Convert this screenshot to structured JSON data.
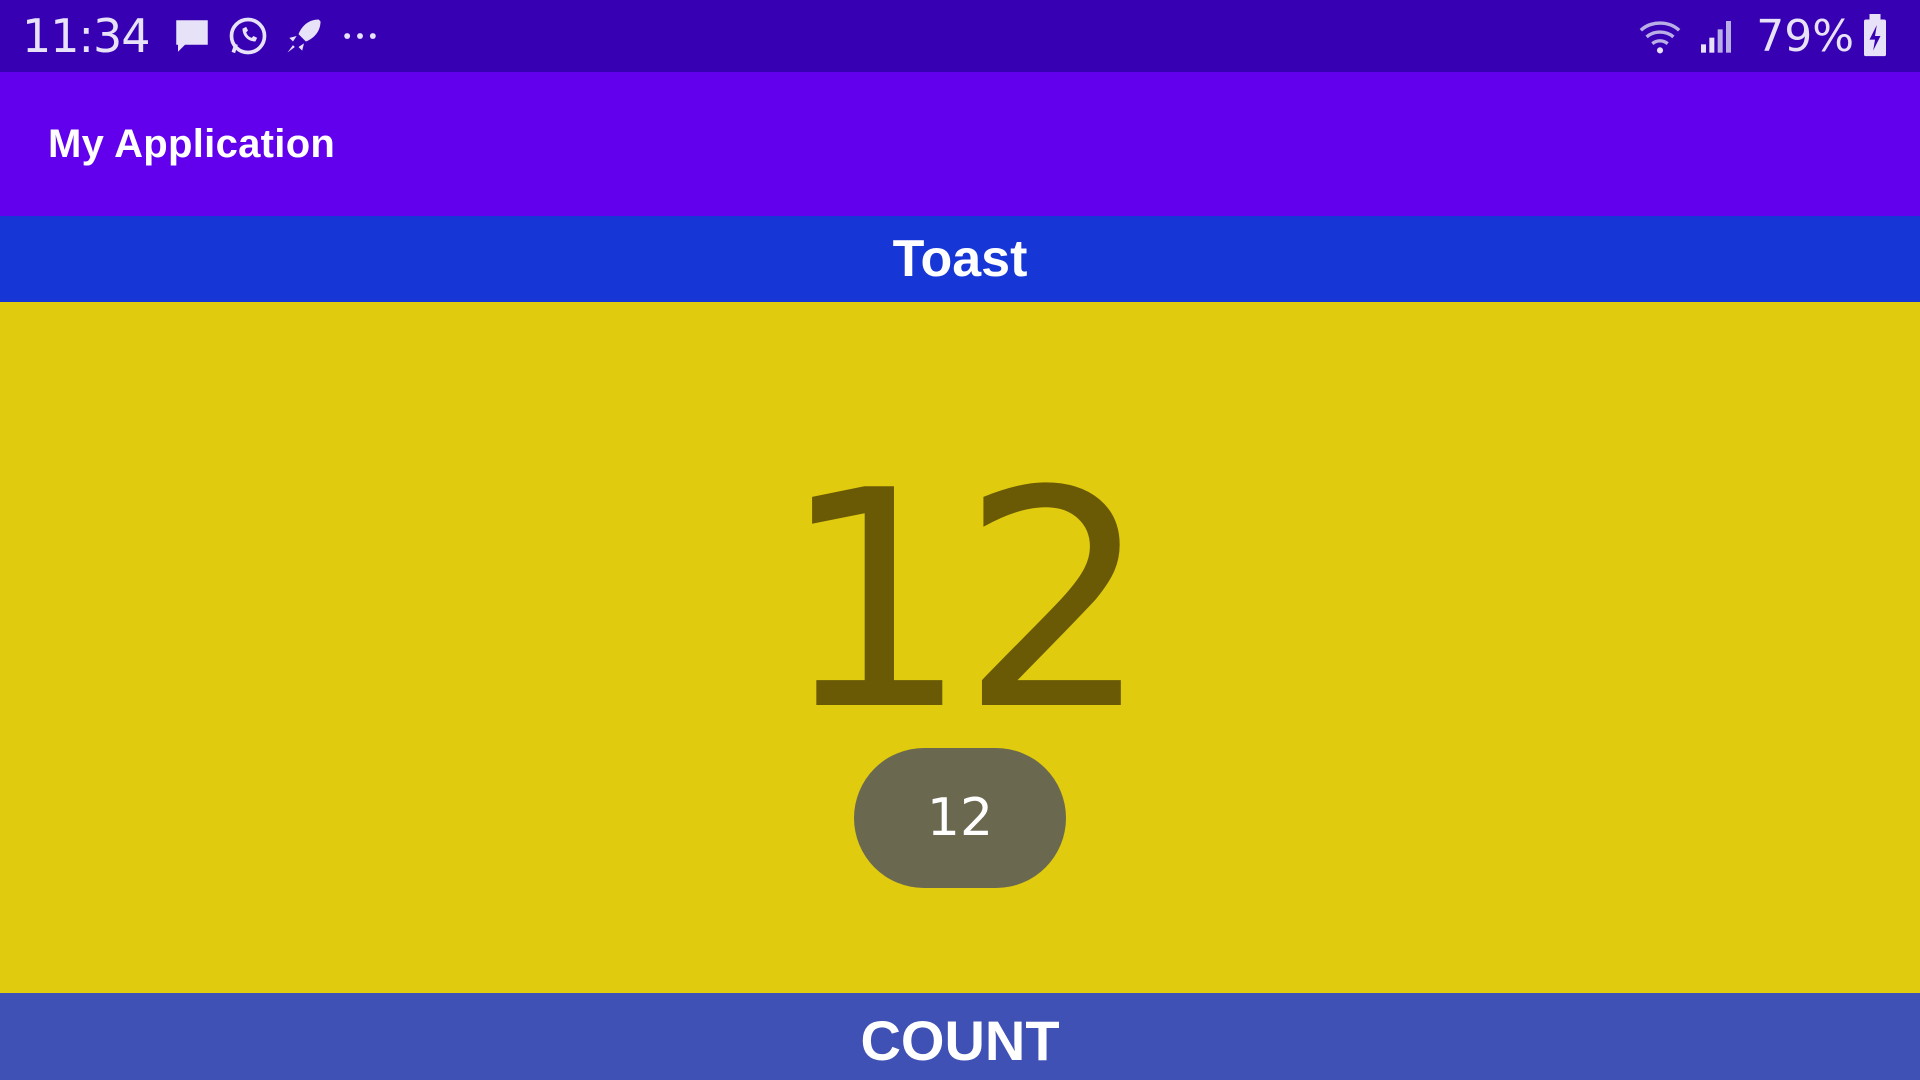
{
  "status_bar": {
    "time": "11:34",
    "notification_icons": [
      "message-icon",
      "whatsapp-icon",
      "rocket-icon",
      "more-dots-icon"
    ],
    "system_icons": [
      "wifi-icon",
      "signal-icon",
      "battery-charging-icon"
    ],
    "battery_percent": "79%",
    "background_color": "#3700b3"
  },
  "app_bar": {
    "title": "My Application",
    "background_color": "#6200ee"
  },
  "toast_button": {
    "label": "Toast",
    "background_color": "#1637d6"
  },
  "content": {
    "count": "12",
    "background_color": "#e0cb0e",
    "count_color": "#6a5a06"
  },
  "toast_popup": {
    "message": "12"
  },
  "count_button": {
    "label": "COUNT",
    "background_color": "#3f51b5"
  }
}
